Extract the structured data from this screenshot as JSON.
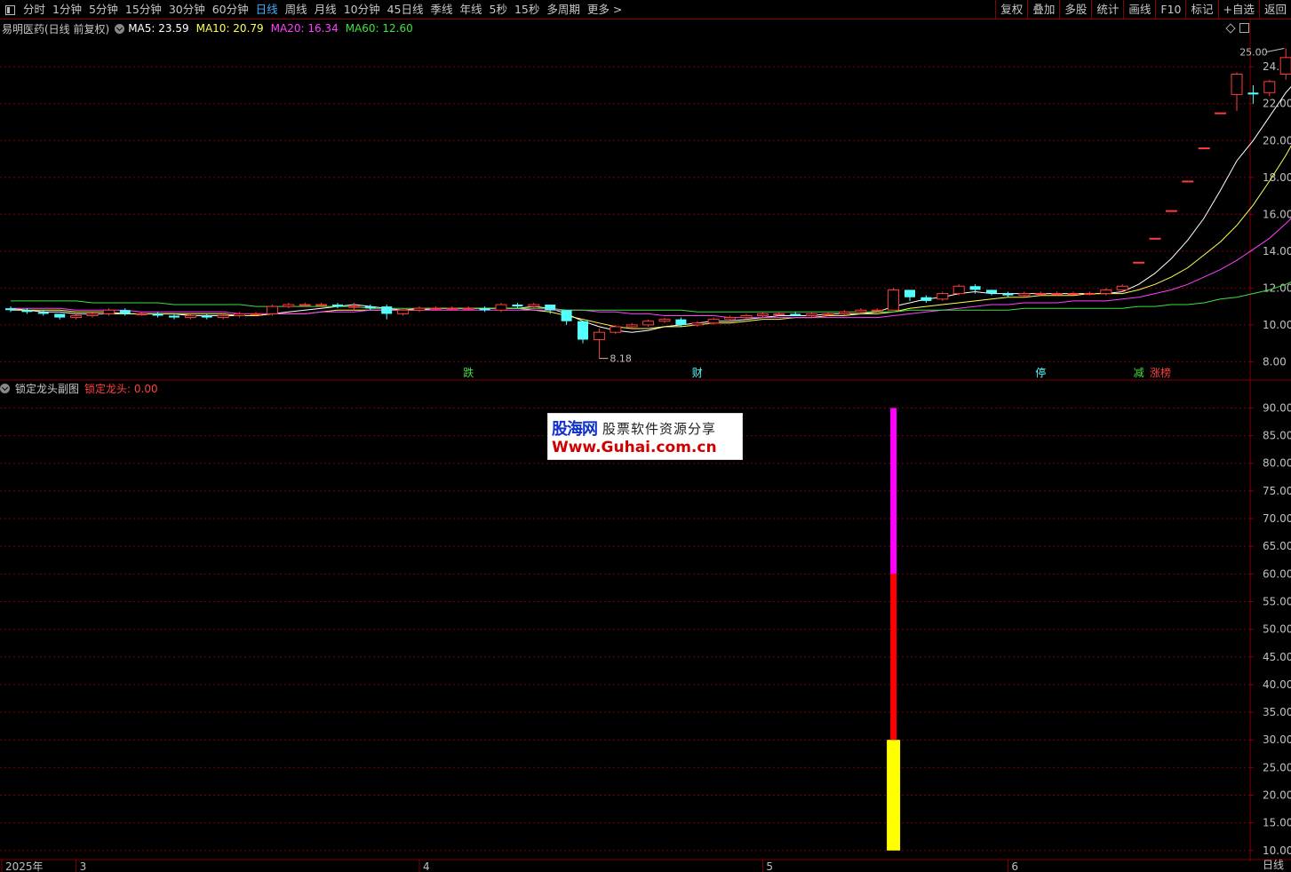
{
  "toolbar": {
    "periods": [
      {
        "label": "分时",
        "active": false
      },
      {
        "label": "1分钟",
        "active": false
      },
      {
        "label": "5分钟",
        "active": false
      },
      {
        "label": "15分钟",
        "active": false
      },
      {
        "label": "30分钟",
        "active": false
      },
      {
        "label": "60分钟",
        "active": false
      },
      {
        "label": "日线",
        "active": true
      },
      {
        "label": "周线",
        "active": false
      },
      {
        "label": "月线",
        "active": false
      },
      {
        "label": "10分钟",
        "active": false
      },
      {
        "label": "45日线",
        "active": false
      },
      {
        "label": "季线",
        "active": false
      },
      {
        "label": "年线",
        "active": false
      },
      {
        "label": "5秒",
        "active": false
      },
      {
        "label": "15秒",
        "active": false
      },
      {
        "label": "多周期",
        "active": false
      },
      {
        "label": "更多 >",
        "active": false
      }
    ],
    "right_buttons": [
      "复权",
      "叠加",
      "多股",
      "统计",
      "画线",
      "F10",
      "标记",
      "+自选",
      "返回"
    ]
  },
  "main_header": {
    "stock_name": "易明医药(日线 前复权)",
    "ma5_label": "MA5: 23.59",
    "ma10_label": "MA10: 20.79",
    "ma20_label": "MA20: 16.34",
    "ma60_label": "MA60: 12.60"
  },
  "sub_header": {
    "title": "锁定龙头副图",
    "value_label": "锁定龙头: 0.00"
  },
  "watermark": {
    "logo": "股海网",
    "slogan": "股票软件资源分享",
    "url": "Www.Guhai.com.cn"
  },
  "bottom_right_label": "日线",
  "colors": {
    "up": "#ff3c3c",
    "down": "#54ffff",
    "ma5": "#ffffff",
    "ma10": "#ffff54",
    "ma20": "#ff40ff",
    "ma60": "#40e040",
    "grid": "#800000",
    "axis_text": "#c0c0c0"
  },
  "chart_data": [
    {
      "type": "candlestick",
      "title": "易明医药(日线 前复权)",
      "y_ticks": [
        8.0,
        10.0,
        12.0,
        14.0,
        16.0,
        18.0,
        20.0,
        22.0,
        24.0
      ],
      "ylim": [
        7.2,
        25.6
      ],
      "candles": [
        [
          10.9,
          11.0,
          10.7,
          10.8
        ],
        [
          10.8,
          10.9,
          10.6,
          10.7
        ],
        [
          10.7,
          10.8,
          10.5,
          10.6
        ],
        [
          10.6,
          10.6,
          10.3,
          10.4
        ],
        [
          10.4,
          10.6,
          10.3,
          10.5
        ],
        [
          10.5,
          10.7,
          10.4,
          10.6
        ],
        [
          10.6,
          10.9,
          10.5,
          10.8
        ],
        [
          10.8,
          10.9,
          10.5,
          10.6
        ],
        [
          10.6,
          10.7,
          10.5,
          10.6
        ],
        [
          10.6,
          10.7,
          10.4,
          10.5
        ],
        [
          10.5,
          10.6,
          10.3,
          10.4
        ],
        [
          10.4,
          10.6,
          10.3,
          10.5
        ],
        [
          10.5,
          10.6,
          10.3,
          10.4
        ],
        [
          10.4,
          10.6,
          10.3,
          10.5
        ],
        [
          10.5,
          10.7,
          10.4,
          10.6
        ],
        [
          10.6,
          10.7,
          10.5,
          10.6
        ],
        [
          10.6,
          11.1,
          10.5,
          11.0
        ],
        [
          11.0,
          11.2,
          10.9,
          11.1
        ],
        [
          11.1,
          11.2,
          11.0,
          11.1
        ],
        [
          11.1,
          11.2,
          11.0,
          11.1
        ],
        [
          11.1,
          11.2,
          10.9,
          11.0
        ],
        [
          11.0,
          11.2,
          10.8,
          11.0
        ],
        [
          11.0,
          11.1,
          10.8,
          10.9
        ],
        [
          11.0,
          11.1,
          10.3,
          10.6
        ],
        [
          10.6,
          10.9,
          10.5,
          10.8
        ],
        [
          10.8,
          11.0,
          10.7,
          10.9
        ],
        [
          10.9,
          11.0,
          10.8,
          10.9
        ],
        [
          10.9,
          11.0,
          10.8,
          10.9
        ],
        [
          10.9,
          11.0,
          10.8,
          10.9
        ],
        [
          10.9,
          11.0,
          10.7,
          10.8
        ],
        [
          10.8,
          11.2,
          10.7,
          11.1
        ],
        [
          11.1,
          11.2,
          10.9,
          11.0
        ],
        [
          11.0,
          11.2,
          10.9,
          11.1
        ],
        [
          11.1,
          11.1,
          10.6,
          10.8
        ],
        [
          10.8,
          10.8,
          10.0,
          10.2
        ],
        [
          10.2,
          10.2,
          9.0,
          9.2
        ],
        [
          9.2,
          9.8,
          8.18,
          9.6
        ],
        [
          9.6,
          10.0,
          9.5,
          9.9
        ],
        [
          9.9,
          10.1,
          9.8,
          10.0
        ],
        [
          10.0,
          10.3,
          9.9,
          10.2
        ],
        [
          10.2,
          10.4,
          10.1,
          10.3
        ],
        [
          10.3,
          10.4,
          9.9,
          10.0
        ],
        [
          10.0,
          10.2,
          9.9,
          10.1
        ],
        [
          10.1,
          10.4,
          10.0,
          10.3
        ],
        [
          10.3,
          10.5,
          10.2,
          10.4
        ],
        [
          10.4,
          10.6,
          10.3,
          10.5
        ],
        [
          10.5,
          10.7,
          10.4,
          10.6
        ],
        [
          10.6,
          10.7,
          10.5,
          10.6
        ],
        [
          10.6,
          10.7,
          10.5,
          10.5
        ],
        [
          10.5,
          10.7,
          10.4,
          10.6
        ],
        [
          10.6,
          10.7,
          10.5,
          10.6
        ],
        [
          10.6,
          10.8,
          10.5,
          10.7
        ],
        [
          10.7,
          10.9,
          10.6,
          10.8
        ],
        [
          10.8,
          10.9,
          10.7,
          10.8
        ],
        [
          10.8,
          12.0,
          10.8,
          11.9
        ],
        [
          11.9,
          11.9,
          11.3,
          11.5
        ],
        [
          11.5,
          11.6,
          11.2,
          11.3
        ],
        [
          11.4,
          11.8,
          11.3,
          11.7
        ],
        [
          11.7,
          12.2,
          11.6,
          12.1
        ],
        [
          12.1,
          12.2,
          11.7,
          11.9
        ],
        [
          11.9,
          11.9,
          11.6,
          11.7
        ],
        [
          11.7,
          11.8,
          11.5,
          11.6
        ],
        [
          11.6,
          11.8,
          11.5,
          11.7
        ],
        [
          11.7,
          11.8,
          11.6,
          11.7
        ],
        [
          11.7,
          11.8,
          11.6,
          11.7
        ],
        [
          11.7,
          11.8,
          11.6,
          11.7
        ],
        [
          11.7,
          11.8,
          11.6,
          11.7
        ],
        [
          11.7,
          12.0,
          11.6,
          11.9
        ],
        [
          11.9,
          12.2,
          11.8,
          12.1
        ],
        [
          13.4,
          13.4,
          13.4,
          13.4
        ],
        [
          14.7,
          14.7,
          14.7,
          14.7
        ],
        [
          16.2,
          16.2,
          16.2,
          16.2
        ],
        [
          17.8,
          17.8,
          17.8,
          17.8
        ],
        [
          19.6,
          19.6,
          19.6,
          19.6
        ],
        [
          21.5,
          21.5,
          21.5,
          21.5
        ],
        [
          22.5,
          23.7,
          21.6,
          23.6
        ],
        [
          22.6,
          23.0,
          22.0,
          22.5
        ],
        [
          22.6,
          23.3,
          22.4,
          23.2
        ],
        [
          23.6,
          25.0,
          23.3,
          24.5
        ],
        [
          23.5,
          24.2,
          23.0,
          24.0
        ]
      ],
      "high_label": "25.00",
      "low_label": "8.18",
      "moving_averages": {
        "MA5": [
          10.8,
          10.8,
          10.7,
          10.7,
          10.6,
          10.6,
          10.6,
          10.6,
          10.6,
          10.6,
          10.6,
          10.5,
          10.5,
          10.5,
          10.5,
          10.5,
          10.6,
          10.7,
          10.8,
          10.9,
          11.0,
          11.1,
          11.0,
          10.9,
          10.8,
          10.8,
          10.9,
          10.9,
          10.9,
          10.9,
          10.9,
          10.9,
          11.0,
          10.9,
          10.6,
          10.2,
          9.9,
          9.7,
          9.6,
          9.7,
          9.9,
          10.0,
          10.1,
          10.2,
          10.2,
          10.3,
          10.4,
          10.5,
          10.5,
          10.5,
          10.6,
          10.6,
          10.6,
          10.7,
          11.0,
          11.2,
          11.4,
          11.5,
          11.7,
          11.8,
          11.7,
          11.7,
          11.7,
          11.7,
          11.7,
          11.7,
          11.7,
          11.7,
          11.8,
          12.2,
          12.8,
          13.6,
          14.6,
          15.8,
          17.3,
          18.9,
          20.0,
          21.3,
          22.6,
          23.59
        ],
        "MA10": [
          10.9,
          10.8,
          10.8,
          10.8,
          10.7,
          10.7,
          10.7,
          10.6,
          10.6,
          10.6,
          10.6,
          10.6,
          10.6,
          10.6,
          10.5,
          10.5,
          10.6,
          10.6,
          10.6,
          10.7,
          10.8,
          10.8,
          10.8,
          10.8,
          10.8,
          10.9,
          10.9,
          10.9,
          10.9,
          10.9,
          10.9,
          10.9,
          10.8,
          10.7,
          10.5,
          10.3,
          10.1,
          9.9,
          9.8,
          9.8,
          9.9,
          9.9,
          10.0,
          10.1,
          10.1,
          10.2,
          10.3,
          10.3,
          10.4,
          10.4,
          10.5,
          10.5,
          10.6,
          10.6,
          10.7,
          10.9,
          11.0,
          11.1,
          11.2,
          11.3,
          11.4,
          11.5,
          11.5,
          11.6,
          11.6,
          11.6,
          11.7,
          11.7,
          11.7,
          11.9,
          12.2,
          12.6,
          13.1,
          13.8,
          14.5,
          15.4,
          16.5,
          17.8,
          19.2,
          20.79
        ],
        "MA20": [
          10.9,
          10.9,
          10.9,
          10.9,
          10.8,
          10.8,
          10.8,
          10.8,
          10.7,
          10.7,
          10.7,
          10.7,
          10.7,
          10.7,
          10.6,
          10.6,
          10.6,
          10.6,
          10.6,
          10.7,
          10.7,
          10.7,
          10.8,
          10.8,
          10.8,
          10.8,
          10.8,
          10.8,
          10.8,
          10.8,
          10.8,
          10.8,
          10.8,
          10.8,
          10.8,
          10.8,
          10.7,
          10.7,
          10.6,
          10.6,
          10.5,
          10.5,
          10.5,
          10.5,
          10.4,
          10.4,
          10.4,
          10.4,
          10.4,
          10.4,
          10.4,
          10.4,
          10.4,
          10.4,
          10.5,
          10.6,
          10.7,
          10.8,
          10.9,
          11.0,
          11.1,
          11.1,
          11.2,
          11.2,
          11.2,
          11.3,
          11.3,
          11.3,
          11.4,
          11.5,
          11.7,
          11.9,
          12.2,
          12.6,
          13.0,
          13.5,
          14.1,
          14.7,
          15.5,
          16.34
        ],
        "MA60": [
          11.3,
          11.3,
          11.3,
          11.3,
          11.3,
          11.2,
          11.2,
          11.2,
          11.2,
          11.2,
          11.1,
          11.1,
          11.1,
          11.1,
          11.1,
          11.0,
          11.0,
          11.0,
          11.0,
          11.0,
          11.0,
          11.0,
          10.9,
          10.9,
          10.9,
          10.9,
          10.9,
          10.9,
          10.9,
          10.9,
          10.9,
          10.9,
          10.9,
          10.9,
          10.8,
          10.8,
          10.8,
          10.8,
          10.8,
          10.8,
          10.8,
          10.8,
          10.7,
          10.7,
          10.7,
          10.7,
          10.7,
          10.7,
          10.7,
          10.7,
          10.7,
          10.7,
          10.7,
          10.7,
          10.7,
          10.8,
          10.8,
          10.8,
          10.8,
          10.8,
          10.8,
          10.8,
          10.9,
          10.9,
          10.9,
          10.9,
          10.9,
          10.9,
          10.9,
          11.0,
          11.0,
          11.1,
          11.1,
          11.2,
          11.4,
          11.5,
          11.7,
          11.9,
          12.2,
          12.6
        ]
      },
      "event_markers": [
        {
          "index": 28,
          "text": "跌",
          "color": "#40e040"
        },
        {
          "index": 42,
          "text": "财",
          "color": "#54ffff"
        },
        {
          "index": 63,
          "text": "停",
          "color": "#54ffff"
        },
        {
          "index": 69,
          "text": "减",
          "color": "#40e040"
        },
        {
          "index": 70,
          "text": "涨榜",
          "color": "#ff4040"
        }
      ],
      "x_labels": [
        {
          "index": 0,
          "text": "2025年"
        },
        {
          "index": 4,
          "text": "3"
        },
        {
          "index": 25,
          "text": "4"
        },
        {
          "index": 46,
          "text": "5"
        },
        {
          "index": 61,
          "text": "6"
        }
      ]
    },
    {
      "type": "bar",
      "title": "锁定龙头副图",
      "y_ticks": [
        10.0,
        15.0,
        20.0,
        25.0,
        30.0,
        35.0,
        40.0,
        45.0,
        50.0,
        55.0,
        60.0,
        65.0,
        70.0,
        75.0,
        80.0,
        85.0,
        90.0
      ],
      "ylim": [
        9,
        92
      ],
      "stacked_bar": {
        "index": 54,
        "segments": [
          {
            "from": 10,
            "to": 30,
            "color": "#ffff00"
          },
          {
            "from": 30,
            "to": 60,
            "color": "#ff0000"
          },
          {
            "from": 60,
            "to": 90,
            "color": "#ff00ff"
          }
        ]
      }
    }
  ]
}
